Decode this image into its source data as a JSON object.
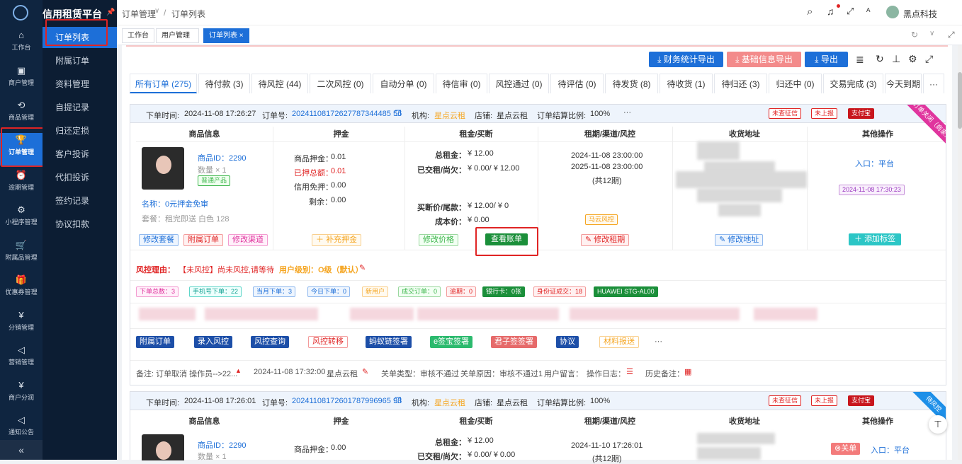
{
  "app": {
    "title": "信用租赁平台"
  },
  "rail": [
    {
      "icon": "⌂",
      "label": "工作台"
    },
    {
      "icon": "▣",
      "label": "商户管理"
    },
    {
      "icon": "⟲",
      "label": "商品管理"
    },
    {
      "icon": "🏆",
      "label": "订单管理"
    },
    {
      "icon": "⏰",
      "label": "逾期管理"
    },
    {
      "icon": "⚙",
      "label": "小程序管理"
    },
    {
      "icon": "🛒",
      "label": "附属品管理"
    },
    {
      "icon": "🎁",
      "label": "优惠券管理"
    },
    {
      "icon": "¥",
      "label": "分销管理"
    },
    {
      "icon": "◁",
      "label": "营销管理"
    },
    {
      "icon": "¥",
      "label": "商户分润"
    },
    {
      "icon": "◁",
      "label": "通知公告"
    }
  ],
  "rail_collapse": "«",
  "submenu": [
    "订单列表",
    "附属订单",
    "资料管理",
    "自提记录",
    "归还定损",
    "客户投诉",
    "代扣投诉",
    "签约记录",
    "协议扣款"
  ],
  "breadcrumb": {
    "parent": "订单管理",
    "sep": "/",
    "current": "订单列表"
  },
  "header": {
    "user": "黑点科技",
    "lang": "ᴬ"
  },
  "tags": [
    {
      "label": "工作台"
    },
    {
      "label": "用户管理"
    },
    {
      "label": "订单列表",
      "close": "×"
    }
  ],
  "toolbar": {
    "finance_export": "财务统计导出",
    "basic_export": "基础信息导出",
    "export": "导出"
  },
  "tabs": [
    "所有订单 (275)",
    "待付款 (3)",
    "待风控 (44)",
    "二次风控 (0)",
    "自动分单 (0)",
    "待信审 (0)",
    "风控通过 (0)",
    "待评估 (0)",
    "待发货 (8)",
    "待收货 (1)",
    "待归还 (3)",
    "归还中 (0)",
    "交易完成 (3)",
    "今天到期"
  ],
  "tabs_more": "···",
  "orders": [
    {
      "time_label": "下单时间:",
      "time": "2024-11-08 17:26:27",
      "no_label": "订单号:",
      "no": "20241108172627787344485 56",
      "org_label": "机构:",
      "org": "星点云租",
      "shop_label": "店铺:",
      "shop": "星点云租",
      "ratio_label": "订单结算比例:",
      "ratio": "100%",
      "more": "···",
      "status_tags": [
        "未查征信",
        "未上报",
        "支付宝"
      ],
      "ribbon": "订单关闭（商家）",
      "columns": [
        "商品信息",
        "押金",
        "租金/买断",
        "租期/渠道/风控",
        "收货地址",
        "其他操作"
      ],
      "product_id": "商品ID：2290",
      "qty": "数量 × 1",
      "product_tag": "普通产品",
      "name": "名称：0元押金免审",
      "package": "套餐：租完即送 白色 128",
      "deposit": [
        "商品押金：",
        "0.01",
        "已押总额：",
        "0.01",
        "信用免押：",
        "0.00",
        "剩余：",
        "0.00"
      ],
      "rent": [
        "总租金：",
        "¥ 12.00",
        "已交租/尚欠：",
        "¥ 0.00/ ¥ 12.00",
        "买断价/尾款：",
        "¥ 12.00/ ¥ 0",
        "成本价：",
        "¥ 0.00"
      ],
      "period": [
        "2024-11-08 23:00:00",
        "2025-11-08 23:00:00",
        "(共12期)"
      ],
      "risk_tag": "马云风控",
      "entry": "入口：平台",
      "stamp": "2024-11-08 17:30:23",
      "actions": [
        "修改套餐",
        "附属订单",
        "修改渠道",
        "补充押金",
        "修改价格",
        "查看账单",
        "修改租期",
        "修改地址",
        "添加标签"
      ],
      "risk_reason_label": "风控理由：",
      "risk_reason": "【未风控】尚未风控,请等待",
      "user_level": "用户级别：O级（默认）",
      "stats": [
        "下单总数：3",
        "手机号下单：22",
        "当月下单：3",
        "今日下单：0",
        "新用户",
        "成交订单：0",
        "逾期：0",
        "银行卡：0张",
        "身份证成交：18",
        "HUAWEI STG-AL00"
      ],
      "ops": [
        "附属订单",
        "录入风控",
        "风控查询",
        "风控转移",
        "蚂蚁链签署",
        "e签宝签署",
        "君子签签署",
        "协议",
        "材料报送",
        "···"
      ],
      "remark": "备注: 订单取消 操作员-->22...",
      "remark_time": "2024-11-08 17:32:00",
      "remark_org": "星点云租",
      "close_type": "关单类型：审核不通过",
      "close_reason": "关单原因：审核不通过1",
      "user_msg": "用户留言：",
      "op_log": "操作日志：",
      "history": "历史备注："
    },
    {
      "time_label": "下单时间:",
      "time": "2024-11-08 17:26:01",
      "no_label": "订单号:",
      "no": "20241108172601787996965 98",
      "org_label": "机构:",
      "org": "星点云租",
      "shop_label": "店铺:",
      "shop": "星点云租",
      "ratio_label": "订单结算比例:",
      "ratio": "100%",
      "status_tags": [
        "未查征信",
        "未上报",
        "支付宝"
      ],
      "ribbon": "待风控",
      "columns": [
        "商品信息",
        "押金",
        "租金/买断",
        "租期/渠道/风控",
        "收货地址",
        "其他操作"
      ],
      "product_id": "商品ID：2290",
      "qty": "数量 × 1",
      "deposit": [
        "商品押金：",
        "0.00"
      ],
      "rent": [
        "总租金：",
        "¥ 12.00",
        "已交租/尚欠：",
        "¥ 0.00/ ¥ 0.00"
      ],
      "period": [
        "2024-11-10 17:26:01",
        "(共12期)"
      ],
      "close_btn": "关单",
      "entry": "入口：平台"
    }
  ]
}
